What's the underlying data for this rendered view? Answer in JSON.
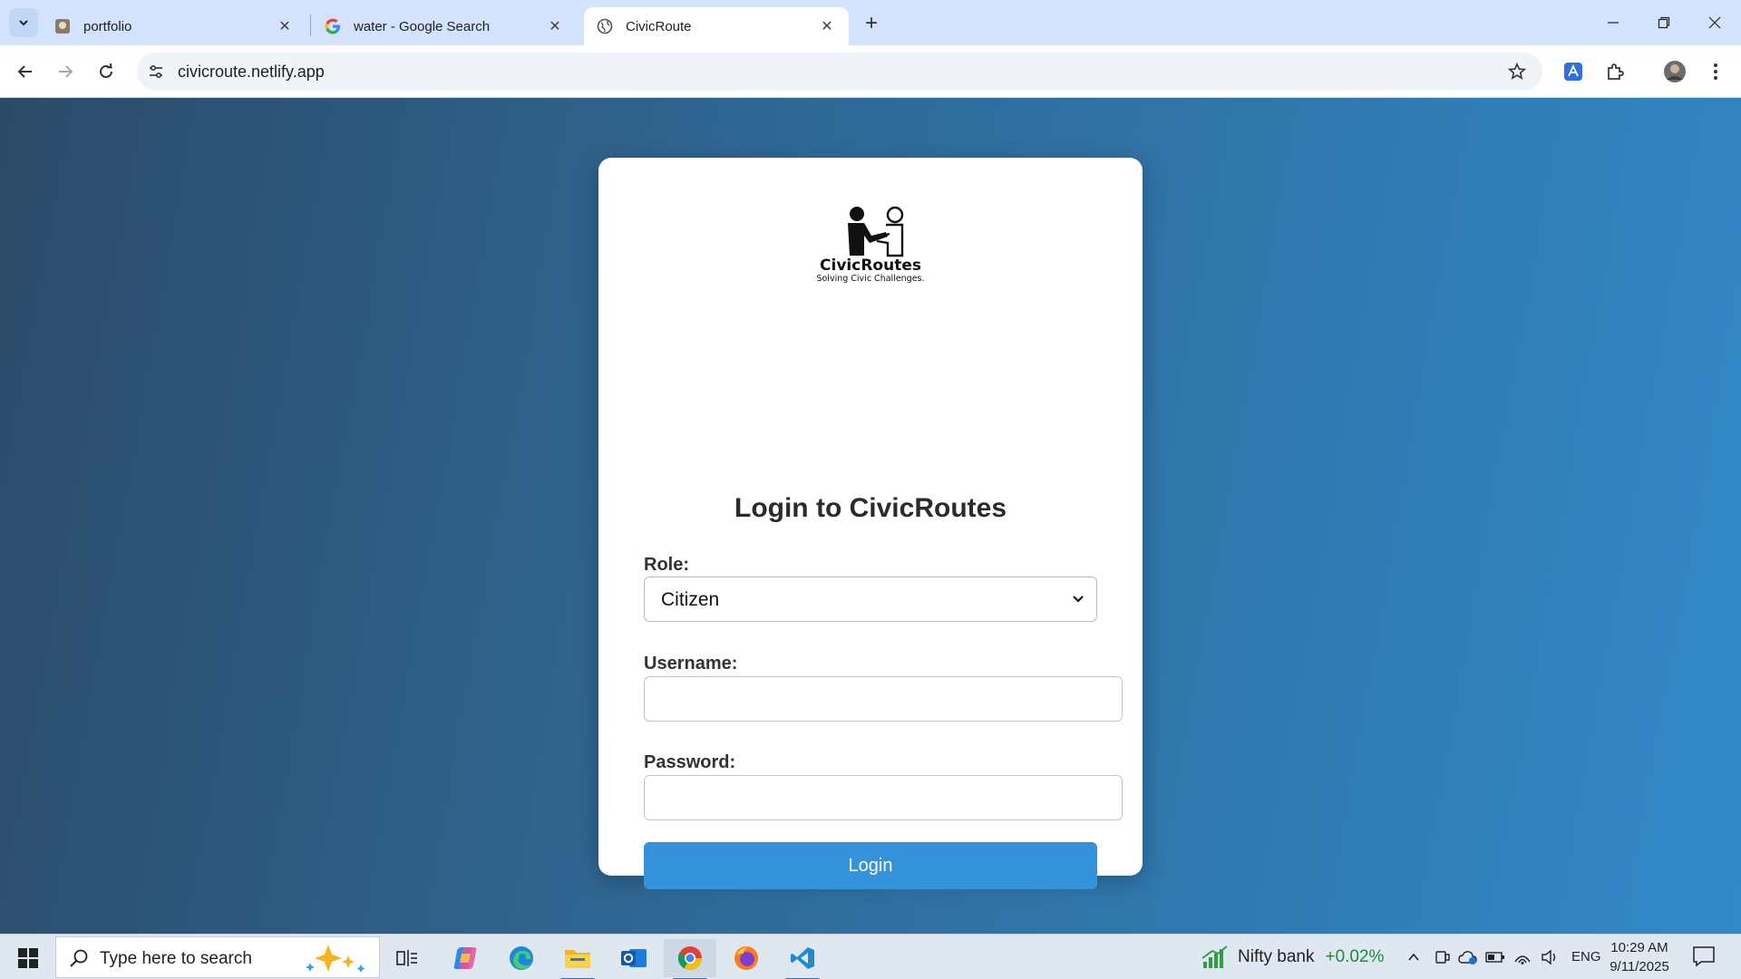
{
  "browser": {
    "tabs": [
      {
        "title": "portfolio",
        "icon": "portfolio-favicon"
      },
      {
        "title": "water - Google Search",
        "icon": "google-icon"
      },
      {
        "title": "CivicRoute",
        "icon": "globe-icon",
        "active": true
      }
    ],
    "url": "civicroute.netlify.app"
  },
  "logo": {
    "name": "CivicRoutes",
    "tagline": "Solving Civic Challenges."
  },
  "login": {
    "heading": "Login to CivicRoutes",
    "role_label": "Role:",
    "role_value": "Citizen",
    "username_label": "Username:",
    "username_value": "",
    "password_label": "Password:",
    "password_value": "",
    "button_label": "Login"
  },
  "taskbar": {
    "search_placeholder": "Type here to search",
    "ticker_name": "Nifty bank",
    "ticker_change": "+0.02%",
    "language": "ENG",
    "time": "10:29 AM",
    "date": "9/11/2025"
  },
  "colors": {
    "primary_button": "#3593db",
    "page_gradient_start": "#2c4a68",
    "page_gradient_end": "#3289c8",
    "ticker_positive": "#1e8a3a"
  }
}
